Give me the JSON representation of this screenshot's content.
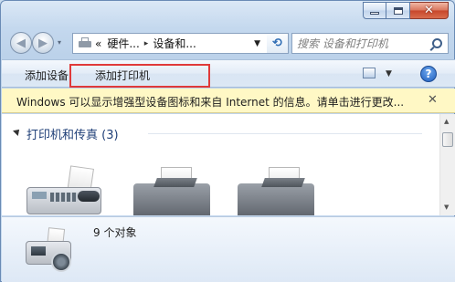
{
  "window": {
    "caption_buttons": {
      "minimize_icon": "minimize-icon",
      "maximize_icon": "maximize-icon",
      "close_glyph": "✕"
    }
  },
  "nav": {
    "back_glyph": "◀",
    "forward_glyph": "▶",
    "history_glyph": "▾",
    "breadcrumb": {
      "prefix": "«",
      "item1": "硬件...",
      "item2": "设备和...",
      "separator": "▸"
    },
    "address_dropdown_glyph": "▼",
    "refresh_glyph": "⟲",
    "search": {
      "placeholder": "搜索 设备和打印机"
    }
  },
  "toolbar": {
    "add_device_label": "添加设备",
    "add_printer_label": "添加打印机",
    "view_dropdown_glyph": "▼",
    "help_label": "?",
    "highlight_color": "#e03a3a"
  },
  "infobar": {
    "message": "Windows 可以显示增强型设备图标和来自 Internet 的信息。请单击进行更改...",
    "close_glyph": "✕"
  },
  "content": {
    "group_header": "打印机和传真 (3)",
    "scroll_up_glyph": "▲",
    "scroll_down_glyph": "▼",
    "devices": [
      {
        "icon": "fax-icon"
      },
      {
        "icon": "printer-icon"
      },
      {
        "icon": "printer-icon"
      }
    ]
  },
  "details": {
    "icon": "fax-icon",
    "count_text": "9 个对象"
  }
}
